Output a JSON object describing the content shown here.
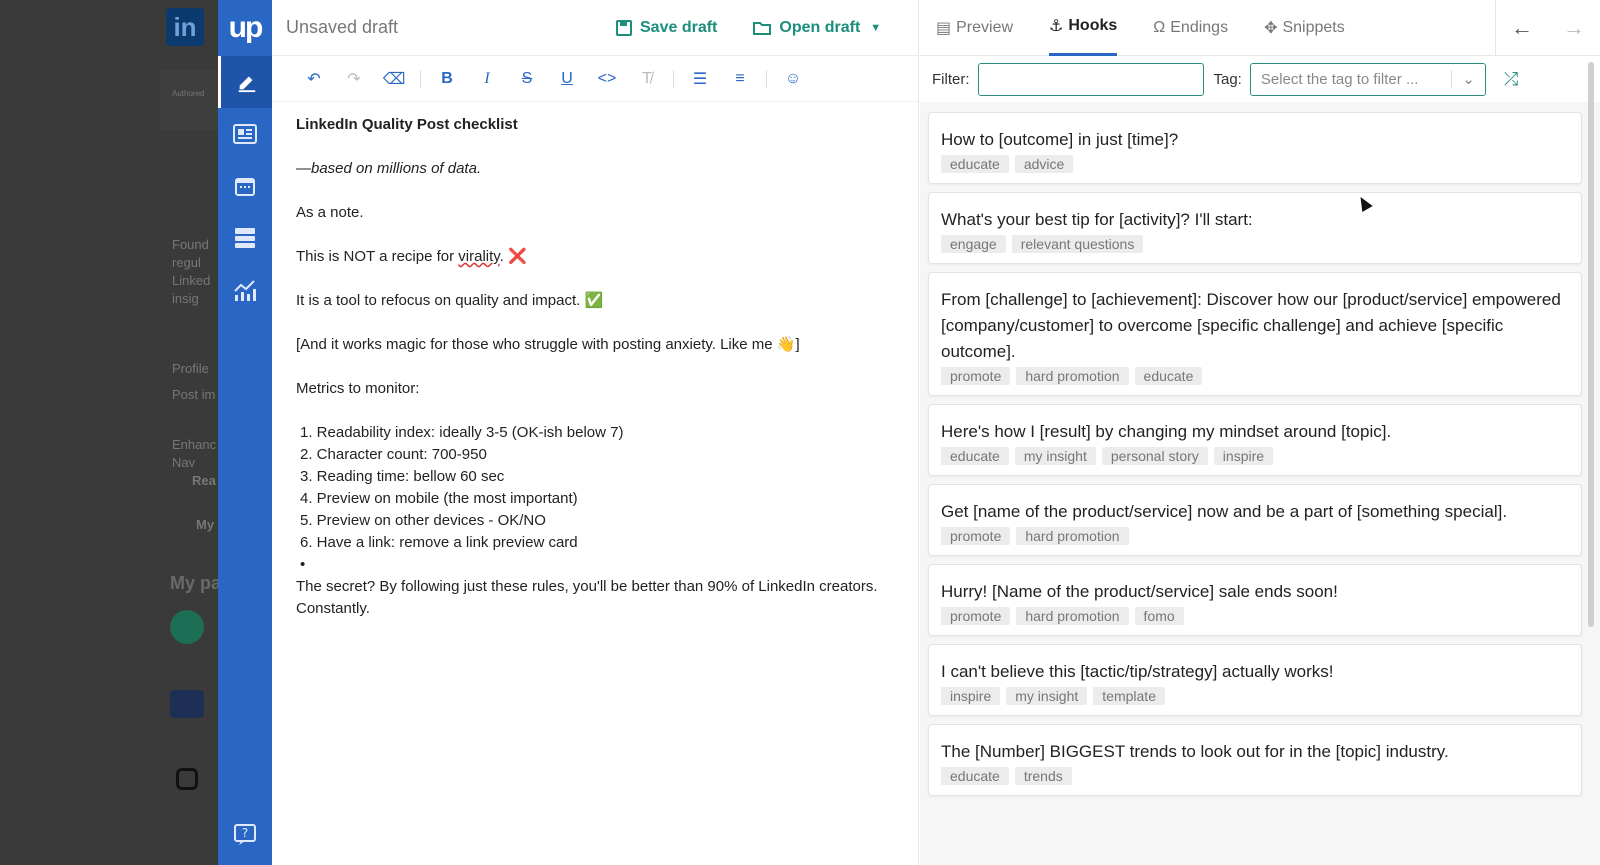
{
  "background": {
    "logo": "in",
    "snippets": [
      "Authored",
      "Found\nregul\nLinked\ninsig",
      "Profile",
      "Post im",
      "Enhanc\nNav",
      "Rea",
      "My"
    ],
    "heading": "My pa"
  },
  "rail": {
    "logo": "up",
    "items": [
      "edit-icon",
      "newspaper-icon",
      "calendar-icon",
      "archive-icon",
      "analytics-icon"
    ],
    "help": "help-icon"
  },
  "toolbar": {
    "title": "Unsaved draft",
    "save_label": "Save draft",
    "open_label": "Open draft"
  },
  "format_bar": [
    "undo",
    "redo",
    "eraser",
    "B",
    "I",
    "S",
    "U",
    "<>",
    "clear-format",
    "bullet-list",
    "numbered-list",
    "emoji"
  ],
  "document": {
    "title": "LinkedIn Quality Post checklist",
    "subtitle": "—based on millions of data.",
    "p1": "As a note.",
    "p2_before": "This is NOT a recipe for ",
    "p2_word": "virality",
    "p2_after": ". ❌",
    "p3": "It is a tool to refocus on quality and impact. ✅",
    "p4": "[And it works magic for those who struggle with posting anxiety. Like me 👋]",
    "p5": "Metrics to monitor:",
    "list": [
      "1. Readability index: ideally 3-5 (OK-ish below 7)",
      "2. Character count: 700-950",
      "3. Reading time: bellow 60 sec",
      "4. Preview on mobile (the most important)",
      "5. Preview on other devices - OK/NO",
      "6. Have a link: remove a link preview card"
    ],
    "bullet": "•",
    "closing": "The secret? By following just these rules, you'll be better than 90% of LinkedIn creators. Constantly."
  },
  "side": {
    "tabs": [
      {
        "label": "Preview",
        "icon": "preview-icon"
      },
      {
        "label": "Hooks",
        "icon": "hook-icon"
      },
      {
        "label": "Endings",
        "icon": "omega-icon"
      },
      {
        "label": "Snippets",
        "icon": "puzzle-icon"
      }
    ],
    "active_tab": "Hooks",
    "filter_label": "Filter:",
    "filter_value": "",
    "tag_label": "Tag:",
    "tag_placeholder": "Select the tag to filter ...",
    "hooks": [
      {
        "text": "How to [outcome] in just [time]?",
        "tags": [
          "educate",
          "advice"
        ]
      },
      {
        "text": "What's your best tip for [activity]? I'll start:",
        "tags": [
          "engage",
          "relevant questions"
        ]
      },
      {
        "text": "From [challenge] to [achievement]: Discover how our [product/service] empowered [company/customer] to overcome [specific challenge] and achieve [specific outcome].",
        "tags": [
          "promote",
          "hard promotion",
          "educate"
        ]
      },
      {
        "text": "Here's how I [result] by changing my mindset around [topic].",
        "tags": [
          "educate",
          "my insight",
          "personal story",
          "inspire"
        ]
      },
      {
        "text": "Get [name of the product/service] now and be a part of [something special].",
        "tags": [
          "promote",
          "hard promotion"
        ]
      },
      {
        "text": "Hurry! [Name of the product/service] sale ends soon!",
        "tags": [
          "promote",
          "hard promotion",
          "fomo"
        ]
      },
      {
        "text": "I can't believe this [tactic/tip/strategy] actually works!",
        "tags": [
          "inspire",
          "my insight",
          "template"
        ]
      },
      {
        "text": "The [Number] BIGGEST trends to look out for in the [topic] industry.",
        "tags": [
          "educate",
          "trends"
        ]
      }
    ]
  },
  "colors": {
    "rail": "#2a66c4",
    "accent_green": "#1c8e7c",
    "tab_underline": "#2a66c4"
  }
}
